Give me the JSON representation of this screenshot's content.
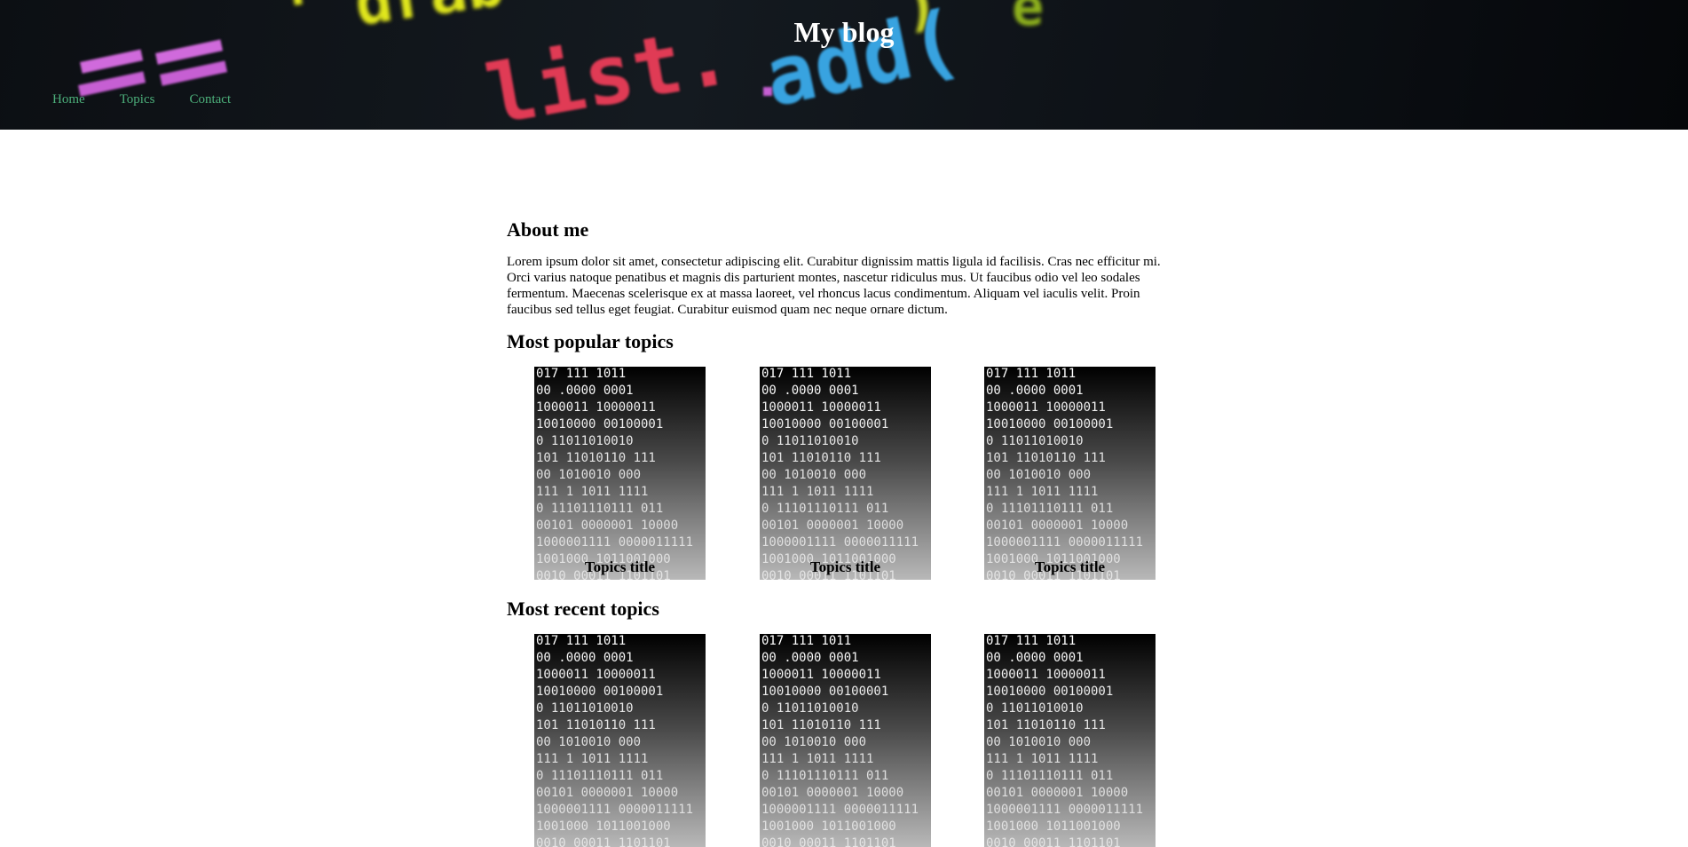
{
  "header": {
    "title": "My blog",
    "nav": [
      {
        "label": "Home"
      },
      {
        "label": "Topics"
      },
      {
        "label": "Contact"
      }
    ]
  },
  "about": {
    "heading": "About me",
    "text": "Lorem ipsum dolor sit amet, consectetur adipiscing elit. Curabitur dignissim mattis ligula id facilisis. Cras nec efficitur mi. Orci varius natoque penatibus et magnis dis parturient montes, nascetur ridiculus mus. Ut faucibus odio vel leo sodales fermentum. Maecenas scelerisque ex at massa laoreet, vel rhoncus lacus condimentum. Aliquam vel iaculis velit. Proin faucibus sed tellus eget feugiat. Curabitur euismod quam nec neque ornare dictum."
  },
  "popular": {
    "heading": "Most popular topics",
    "cards": [
      {
        "title": "Topics title"
      },
      {
        "title": "Topics title"
      },
      {
        "title": "Topics title"
      }
    ]
  },
  "recent": {
    "heading": "Most recent topics",
    "cards": [
      {
        "title": ""
      },
      {
        "title": ""
      },
      {
        "title": ""
      }
    ]
  },
  "colors": {
    "nav_link": "#4caf7a",
    "title": "#ffffff"
  }
}
